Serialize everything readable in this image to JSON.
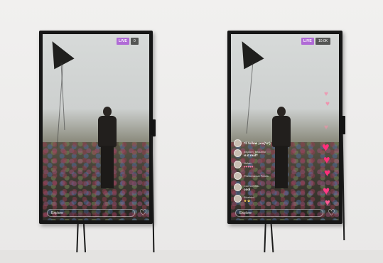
{
  "left_screen": {
    "live_badge": "LIVE",
    "viewer_count": "0",
    "input_placeholder": "Explore",
    "heart_icon": "heart-outline-icon"
  },
  "right_screen": {
    "live_badge": "LIVE",
    "viewer_count": "10.0K",
    "input_placeholder": "Explore",
    "heart_icon": "heart-outline-icon",
    "comments": [
      {
        "user": "",
        "message": "I'll follow you(*o*)"
      },
      {
        "user": "wisdom_beautiful",
        "message": "is it real?"
      },
      {
        "user": "Nolan",
        "message": "♥♥♥♥♥"
      },
      {
        "user": "Phenomenal Pearls",
        "message": ""
      },
      {
        "user": "ConnorShiki",
        "message": "cool"
      },
      {
        "user": "Bluebird",
        "message": "★ ✿"
      }
    ],
    "floating_hearts_color": "#ff2f7a"
  },
  "colors": {
    "wall": "#ecebea",
    "bezel": "#161616",
    "live_badge": "#b06bd6"
  }
}
